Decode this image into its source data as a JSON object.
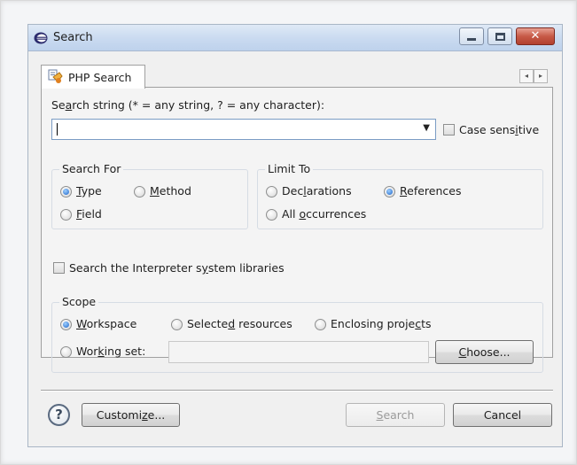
{
  "window": {
    "title": "Search",
    "minimize_glyph": "",
    "close_glyph": "✕"
  },
  "tabs": [
    {
      "label": "PHP Search",
      "selected": true
    }
  ],
  "tab_scroll": {
    "left": "◂",
    "right": "▸"
  },
  "search_string": {
    "label_pre": "Se",
    "label_mnemonic": "a",
    "label_post": "rch string (* = any string, ? = any character):",
    "value": "",
    "dropdown_glyph": "▼"
  },
  "case_sensitive": {
    "label_pre": "Case sens",
    "label_mnemonic": "i",
    "label_post": "tive",
    "checked": false
  },
  "search_for": {
    "title": "Search For",
    "options": [
      {
        "mnemonic": "T",
        "rest": "ype",
        "selected": true
      },
      {
        "mnemonic": "M",
        "rest": "ethod",
        "selected": false
      },
      {
        "mnemonic": "F",
        "rest": "ield",
        "selected": false
      }
    ]
  },
  "limit_to": {
    "title": "Limit To",
    "options": [
      {
        "pre": "Dec",
        "mnemonic": "l",
        "post": "arations",
        "selected": false
      },
      {
        "pre": "",
        "mnemonic": "R",
        "post": "eferences",
        "selected": true
      },
      {
        "pre": "All ",
        "mnemonic": "o",
        "post": "ccurrences",
        "selected": false
      }
    ]
  },
  "interpreter_libs": {
    "label_pre": "Search the Interpreter s",
    "label_mnemonic": "y",
    "label_post": "stem libraries",
    "checked": false
  },
  "scope": {
    "title": "Scope",
    "workspace": {
      "pre": "",
      "mnemonic": "W",
      "post": "orkspace",
      "selected": true
    },
    "selected_resources": {
      "pre": "Selecte",
      "mnemonic": "d",
      "post": " resources",
      "selected": false
    },
    "enclosing_projects": {
      "pre": "Enclosing proje",
      "mnemonic": "c",
      "post": "ts",
      "selected": false
    },
    "working_set": {
      "pre": "Wor",
      "mnemonic": "k",
      "post": "ing set:",
      "selected": false,
      "value": ""
    },
    "choose_button": {
      "pre": "",
      "mnemonic": "C",
      "post": "hoose..."
    }
  },
  "footer": {
    "help_glyph": "?",
    "customize": {
      "pre": "Customi",
      "mnemonic": "z",
      "post": "e..."
    },
    "search": {
      "pre": "",
      "mnemonic": "S",
      "post": "earch",
      "enabled": false
    },
    "cancel": "Cancel"
  },
  "colors": {
    "accent": "#1e64c8",
    "titlebar": "#c9daf0",
    "close_button": "#c75a47"
  }
}
